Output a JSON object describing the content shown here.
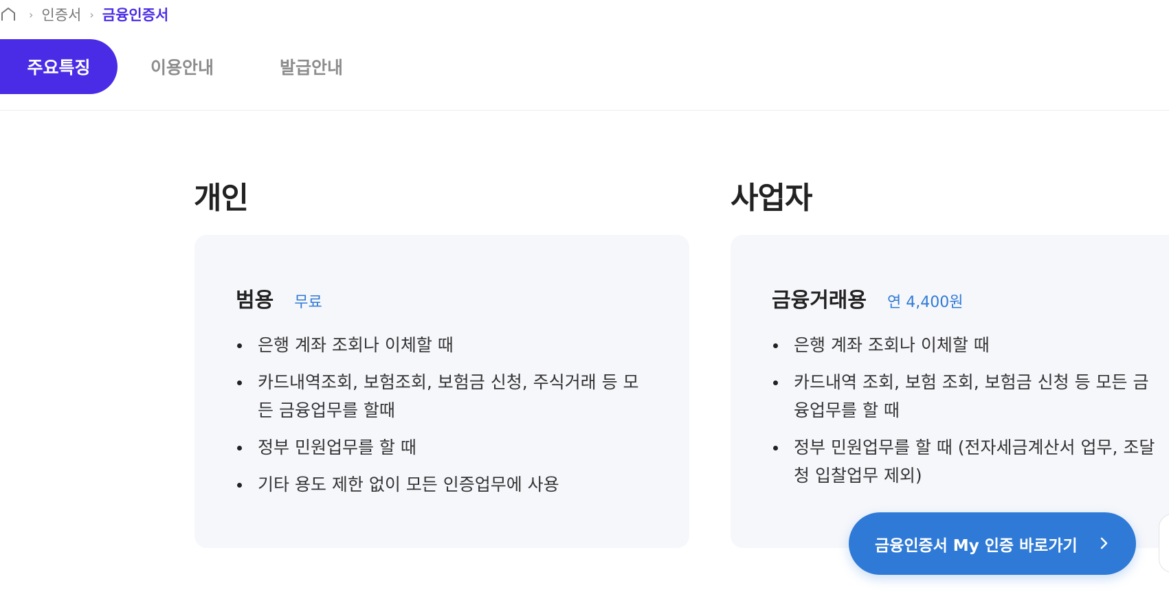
{
  "breadcrumb": {
    "home_icon": "home-icon",
    "items": [
      "인증서",
      "금융인증서"
    ]
  },
  "tabs": [
    {
      "label": "주요특징",
      "active": true
    },
    {
      "label": "이용안내",
      "active": false
    },
    {
      "label": "발급안내",
      "active": false
    }
  ],
  "sections": {
    "personal": {
      "title": "개인",
      "card_name": "범용",
      "card_price": "무료",
      "items": [
        "은행 계좌 조회나 이체할 때",
        "카드내역조회, 보험조회, 보험금 신청, 주식거래 등 모든 금융업무를 할때",
        "정부 민원업무를 할 때",
        "기타 용도 제한 없이 모든 인증업무에 사용"
      ]
    },
    "business": {
      "title": "사업자",
      "card_name": "금융거래용",
      "card_price": "연 4,400원",
      "items": [
        "은행 계좌 조회나 이체할 때",
        "카드내역 조회, 보험 조회, 보험금 신청 등 모든 금융업무를 할 때",
        "정부 민원업무를 할 때 (전자세금계산서 업무, 조달청 입찰업무 제외)"
      ]
    }
  },
  "cta": {
    "label": "금융인증서 My 인증 바로가기",
    "icon": "chevron-right-icon"
  },
  "colors": {
    "primary": "#4b2ce6",
    "accent_blue": "#2f7ad6",
    "card_bg": "#f6f7fb"
  }
}
